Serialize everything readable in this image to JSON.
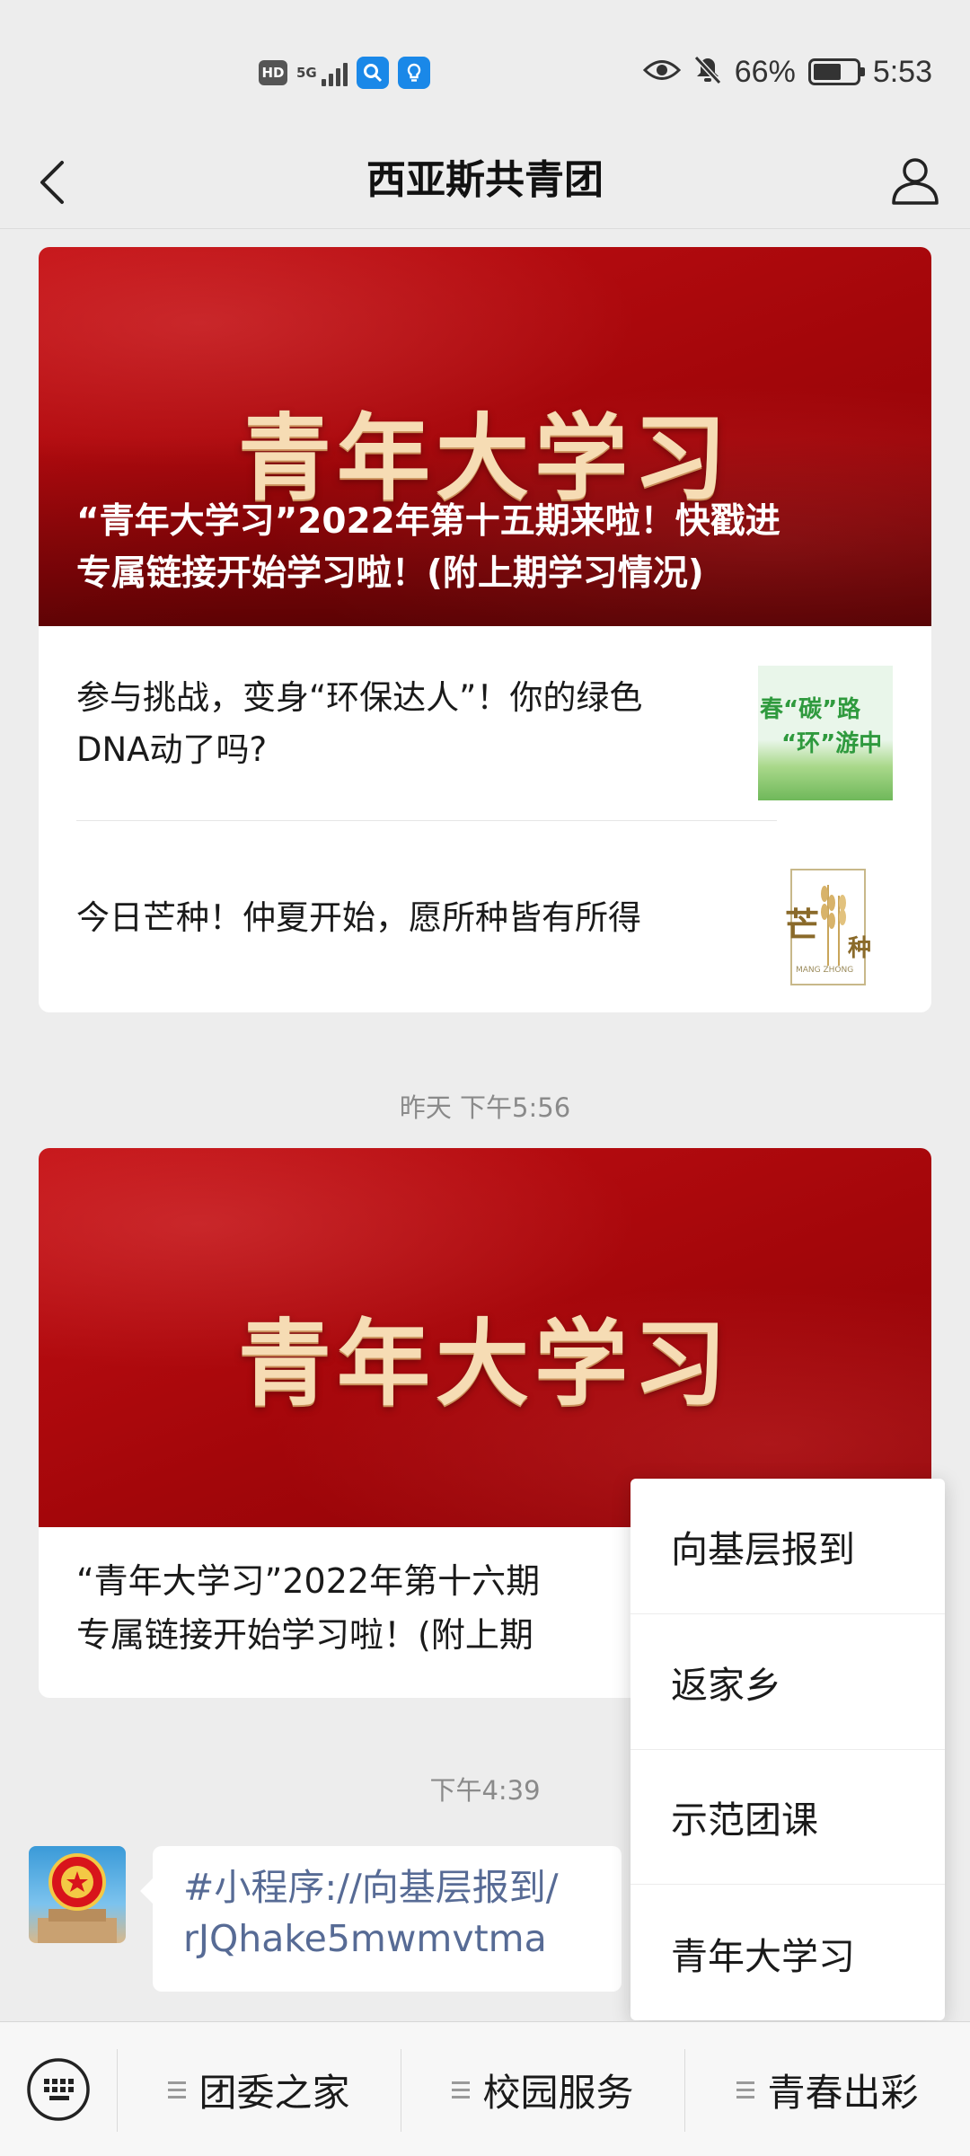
{
  "status_bar": {
    "hd_label": "HD",
    "network_label": "5G",
    "battery_percent": "66%",
    "battery_level": 0.66,
    "time": "5:53"
  },
  "header": {
    "title": "西亚斯共青团"
  },
  "articles": [
    {
      "cover_title": "青年大学习",
      "cover_caption_line1": "“青年大学习”2022年第十五期来啦！快戳进",
      "cover_caption_line2": "专属链接开始学习啦！(附上期学习情况)",
      "sub_items": [
        {
          "line1": "参与挑战，变身“环保达人”！你的绿色",
          "line2": "DNA动了吗?",
          "thumb_line1": "春“碳”路",
          "thumb_line2": "“环”游中"
        },
        {
          "line1": "今日芒种！仲夏开始，愿所种皆有所得",
          "thumb_char1": "芒",
          "thumb_char2": "种",
          "thumb_small": "MANG ZHONG"
        }
      ]
    },
    {
      "cover_title": "青年大学习",
      "text_line1": "“青年大学习”2022年第十六期",
      "text_line2": "专属链接开始学习啦！(附上期"
    }
  ],
  "timestamps": {
    "t1": "昨天 下午5:56",
    "t2": "下午4:39"
  },
  "message": {
    "line1": "#小程序://向基层报到/",
    "line2": "rJQhake5mwmvtma"
  },
  "popup_menu": {
    "items": [
      "向基层报到",
      "返家乡",
      "示范团课",
      "青年大学习"
    ]
  },
  "bottom_menu": {
    "items": [
      "团委之家",
      "校园服务",
      "青春出彩"
    ]
  }
}
